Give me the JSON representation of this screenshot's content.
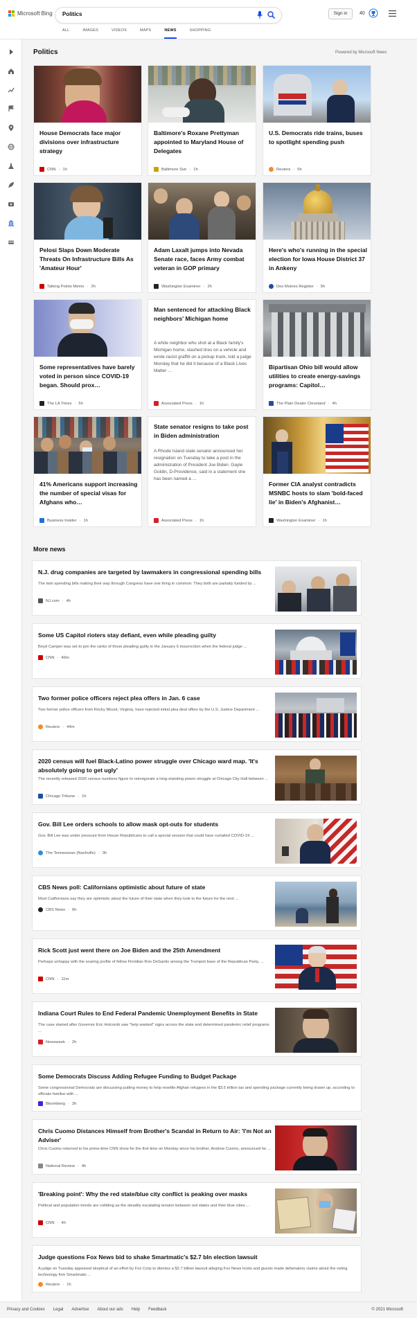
{
  "header": {
    "logo_text": "Microsoft Bing",
    "search_value": "Politics",
    "signin_label": "Sign in",
    "rewards_count": "40",
    "tabs": [
      "ALL",
      "IMAGES",
      "VIDEOS",
      "MAPS",
      "NEWS",
      "SHOPPING"
    ],
    "active_tab": "NEWS"
  },
  "section": {
    "title": "Politics",
    "powered_by": "Powered by Microsoft News"
  },
  "cards": [
    {
      "title": "House Democrats face major divisions over infrastructure strategy",
      "source": "CNN",
      "time": "1h",
      "src_color": "#cc0000"
    },
    {
      "title": "Baltimore's Roxane Prettyman appointed to Maryland House of Delegates",
      "source": "Baltimore Sun",
      "time": "1h",
      "src_color": "#c9a100"
    },
    {
      "title": "U.S. Democrats ride trains, buses to spotlight spending push",
      "source": "Reuters",
      "time": "5h",
      "src_color": "#f28c28"
    },
    {
      "title": "Pelosi Slaps Down Moderate Threats On Infrastructure Bills As 'Amateur Hour'",
      "source": "Talking Points Memo",
      "time": "2h",
      "src_color": "#cc0000"
    },
    {
      "title": "Adam Laxalt jumps into Nevada Senate race, faces Army combat veteran in GOP primary",
      "source": "Washington Examiner",
      "time": "2h",
      "src_color": "#222222"
    },
    {
      "title": "Here's who's running in the special election for Iowa House District 37 in Ankeny",
      "source": "Des Moines Register",
      "time": "5h",
      "src_color": "#1e4fa0"
    },
    {
      "title": "Some representatives have barely voted in person since COVID-19 began. Should prox…",
      "source": "The LA Times",
      "time": "5h",
      "src_color": "#222222"
    },
    {
      "title": "Man sentenced for attacking Black neighbors' Michigan home",
      "desc": "A white neighbor who shot at a Black family's Michigan home, slashed tires on a vehicle and wrote racist graffiti on a pickup truck, told a judge Monday that he did it because of a Black Lives Matter …",
      "source": "Associated Press",
      "time": "1h",
      "src_color": "#d61f26"
    },
    {
      "title": "Bipartisan Ohio bill would allow utilities to create energy-savings programs: Capitol…",
      "source": "The Plain Dealer Cleveland",
      "time": "4h",
      "src_color": "#1e4fa0"
    },
    {
      "title": "41% Americans support increasing the number of special visas for Afghans who…",
      "source": "Business Insider",
      "time": "1h",
      "src_color": "#1e6fd9"
    },
    {
      "title": "State senator resigns to take post in Biden administration",
      "desc": "A Rhode Island state senator announced her resignation on Tuesday to take a post in the administration of President Joe Biden. Gayle Goldin, D-Providence, said in a statement she has been named a …",
      "source": "Associated Press",
      "time": "1h",
      "src_color": "#d61f26"
    },
    {
      "title": "Former CIA analyst contradicts MSNBC hosts to slam 'bold-faced lie' in Biden's Afghanist…",
      "source": "Washington Examiner",
      "time": "1h",
      "src_color": "#222222"
    }
  ],
  "more_news": {
    "title": "More news",
    "items": [
      {
        "title": "N.J. drug companies are targeted by lawmakers in congressional spending bills",
        "desc": "The twin spending bills making their way through Congress have one thing in common: They both are partially funded by ...",
        "source": "NJ.com",
        "time": "4h",
        "src_color": "#555555"
      },
      {
        "title": "Some US Capitol rioters stay defiant, even while pleading guilty",
        "desc": "Boyd Camper was set to join the ranks of those pleading guilty in the January 6 insurrection when the federal judge ...",
        "source": "CNN",
        "time": "40m",
        "src_color": "#cc0000"
      },
      {
        "title": "Two former police officers reject plea offers in Jan. 6 case",
        "desc": "Two former police officers from Rocky Mount, Virginia, have rejected initial plea deal offers by the U.S. Justice Department ...",
        "source": "Reuters",
        "time": "44m",
        "src_color": "#f28c28"
      },
      {
        "title": "2020 census will fuel Black-Latino power struggle over Chicago ward map. 'It's absolutely going to get ugly'",
        "desc": "The recently released 2020 census numbers figure to reinvigorate a long-standing power struggle at Chicago City Hall between ...",
        "source": "Chicago Tribune",
        "time": "1h",
        "src_color": "#1e4fa0"
      },
      {
        "title": "Gov. Bill Lee orders schools to allow mask opt-outs for students",
        "desc": "Gov. Bill Lee was under pressure from House Republicans to call a special session that could have curtailed COVID-19 ...",
        "source": "The Tennessean (Nashville)",
        "time": "3h",
        "src_color": "#2a8fd6"
      },
      {
        "title": "CBS News poll: Californians optimistic about future of state",
        "desc": "Most Californians say they are optimistic about the future of their state when they look to the future for the next ...",
        "source": "CBS News",
        "time": "6h",
        "src_color": "#222222"
      },
      {
        "title": "Rick Scott just went there on Joe Biden and the 25th Amendment",
        "desc": "Perhaps unhappy with the soaring profile of fellow Floridian Ron DeSantis among the Trumpist base of the Republican Party, ...",
        "source": "CNN",
        "time": "11m",
        "src_color": "#cc0000"
      },
      {
        "title": "Indiana Court Rules to End Federal Pandemic Unemployment Benefits in State",
        "desc": "The case started after Governor Eric Holcomb saw \"help wanted\" signs across the state and determined pandemic relief programs ...",
        "source": "Newsweek",
        "time": "2h",
        "src_color": "#d61f26"
      },
      {
        "title": "Some Democrats Discuss Adding Refugee Funding to Budget Package",
        "desc": "Some congressional Democrats are discussing putting money to help resettle Afghan refugees in the $3.5 trillion tax and spending package currently being drawn up, according to officials familiar with ...",
        "source": "Bloomberg",
        "time": "3h",
        "src_color": "#4a1fd6"
      },
      {
        "title": "Chris Cuomo Distances Himself from Brother's Scandal in Return to Air: 'I'm Not an Adviser'",
        "desc": "Chris Cuomo returned to his prime-time CNN show for the first time on Monday since his brother, Andrew Cuomo, announced he ...",
        "source": "National Review",
        "time": "4h",
        "src_color": "#888888"
      },
      {
        "title": "'Breaking point': Why the red state/blue city conflict is peaking over masks",
        "desc": "Political and population trends are colliding as the steadily escalating tension between red states and their blue cities ...",
        "source": "CNN",
        "time": "4h",
        "src_color": "#cc0000"
      },
      {
        "title": "Judge questions Fox News bid to shake Smartmatic's $2.7 bln election lawsuit",
        "desc": "A judge on Tuesday appeared skeptical of an effort by Fox Corp to dismiss a $2.7 billion lawsuit alleging Fox News hosts and guests made defamatory claims about the voting technology firm Smartmatic ...",
        "source": "Reuters",
        "time": "1h",
        "src_color": "#f28c28"
      }
    ]
  },
  "footer": {
    "links": [
      "Privacy and Cookies",
      "Legal",
      "Advertise",
      "About our ads",
      "Help",
      "Feedback"
    ],
    "copyright": "© 2021 Microsoft"
  }
}
